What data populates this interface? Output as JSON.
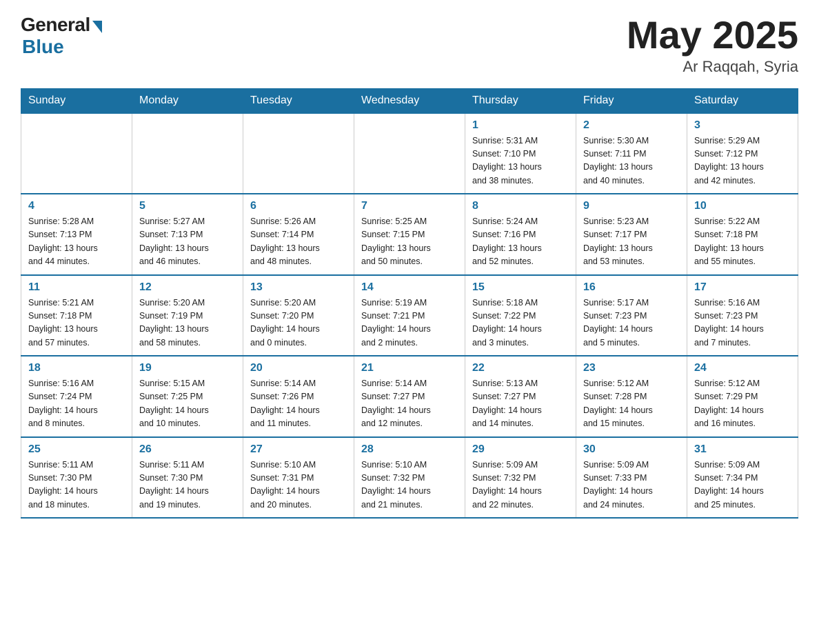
{
  "header": {
    "logo_general": "General",
    "logo_blue": "Blue",
    "title": "May 2025",
    "location": "Ar Raqqah, Syria"
  },
  "days_of_week": [
    "Sunday",
    "Monday",
    "Tuesday",
    "Wednesday",
    "Thursday",
    "Friday",
    "Saturday"
  ],
  "weeks": [
    [
      {
        "day": "",
        "info": ""
      },
      {
        "day": "",
        "info": ""
      },
      {
        "day": "",
        "info": ""
      },
      {
        "day": "",
        "info": ""
      },
      {
        "day": "1",
        "info": "Sunrise: 5:31 AM\nSunset: 7:10 PM\nDaylight: 13 hours\nand 38 minutes."
      },
      {
        "day": "2",
        "info": "Sunrise: 5:30 AM\nSunset: 7:11 PM\nDaylight: 13 hours\nand 40 minutes."
      },
      {
        "day": "3",
        "info": "Sunrise: 5:29 AM\nSunset: 7:12 PM\nDaylight: 13 hours\nand 42 minutes."
      }
    ],
    [
      {
        "day": "4",
        "info": "Sunrise: 5:28 AM\nSunset: 7:13 PM\nDaylight: 13 hours\nand 44 minutes."
      },
      {
        "day": "5",
        "info": "Sunrise: 5:27 AM\nSunset: 7:13 PM\nDaylight: 13 hours\nand 46 minutes."
      },
      {
        "day": "6",
        "info": "Sunrise: 5:26 AM\nSunset: 7:14 PM\nDaylight: 13 hours\nand 48 minutes."
      },
      {
        "day": "7",
        "info": "Sunrise: 5:25 AM\nSunset: 7:15 PM\nDaylight: 13 hours\nand 50 minutes."
      },
      {
        "day": "8",
        "info": "Sunrise: 5:24 AM\nSunset: 7:16 PM\nDaylight: 13 hours\nand 52 minutes."
      },
      {
        "day": "9",
        "info": "Sunrise: 5:23 AM\nSunset: 7:17 PM\nDaylight: 13 hours\nand 53 minutes."
      },
      {
        "day": "10",
        "info": "Sunrise: 5:22 AM\nSunset: 7:18 PM\nDaylight: 13 hours\nand 55 minutes."
      }
    ],
    [
      {
        "day": "11",
        "info": "Sunrise: 5:21 AM\nSunset: 7:18 PM\nDaylight: 13 hours\nand 57 minutes."
      },
      {
        "day": "12",
        "info": "Sunrise: 5:20 AM\nSunset: 7:19 PM\nDaylight: 13 hours\nand 58 minutes."
      },
      {
        "day": "13",
        "info": "Sunrise: 5:20 AM\nSunset: 7:20 PM\nDaylight: 14 hours\nand 0 minutes."
      },
      {
        "day": "14",
        "info": "Sunrise: 5:19 AM\nSunset: 7:21 PM\nDaylight: 14 hours\nand 2 minutes."
      },
      {
        "day": "15",
        "info": "Sunrise: 5:18 AM\nSunset: 7:22 PM\nDaylight: 14 hours\nand 3 minutes."
      },
      {
        "day": "16",
        "info": "Sunrise: 5:17 AM\nSunset: 7:23 PM\nDaylight: 14 hours\nand 5 minutes."
      },
      {
        "day": "17",
        "info": "Sunrise: 5:16 AM\nSunset: 7:23 PM\nDaylight: 14 hours\nand 7 minutes."
      }
    ],
    [
      {
        "day": "18",
        "info": "Sunrise: 5:16 AM\nSunset: 7:24 PM\nDaylight: 14 hours\nand 8 minutes."
      },
      {
        "day": "19",
        "info": "Sunrise: 5:15 AM\nSunset: 7:25 PM\nDaylight: 14 hours\nand 10 minutes."
      },
      {
        "day": "20",
        "info": "Sunrise: 5:14 AM\nSunset: 7:26 PM\nDaylight: 14 hours\nand 11 minutes."
      },
      {
        "day": "21",
        "info": "Sunrise: 5:14 AM\nSunset: 7:27 PM\nDaylight: 14 hours\nand 12 minutes."
      },
      {
        "day": "22",
        "info": "Sunrise: 5:13 AM\nSunset: 7:27 PM\nDaylight: 14 hours\nand 14 minutes."
      },
      {
        "day": "23",
        "info": "Sunrise: 5:12 AM\nSunset: 7:28 PM\nDaylight: 14 hours\nand 15 minutes."
      },
      {
        "day": "24",
        "info": "Sunrise: 5:12 AM\nSunset: 7:29 PM\nDaylight: 14 hours\nand 16 minutes."
      }
    ],
    [
      {
        "day": "25",
        "info": "Sunrise: 5:11 AM\nSunset: 7:30 PM\nDaylight: 14 hours\nand 18 minutes."
      },
      {
        "day": "26",
        "info": "Sunrise: 5:11 AM\nSunset: 7:30 PM\nDaylight: 14 hours\nand 19 minutes."
      },
      {
        "day": "27",
        "info": "Sunrise: 5:10 AM\nSunset: 7:31 PM\nDaylight: 14 hours\nand 20 minutes."
      },
      {
        "day": "28",
        "info": "Sunrise: 5:10 AM\nSunset: 7:32 PM\nDaylight: 14 hours\nand 21 minutes."
      },
      {
        "day": "29",
        "info": "Sunrise: 5:09 AM\nSunset: 7:32 PM\nDaylight: 14 hours\nand 22 minutes."
      },
      {
        "day": "30",
        "info": "Sunrise: 5:09 AM\nSunset: 7:33 PM\nDaylight: 14 hours\nand 24 minutes."
      },
      {
        "day": "31",
        "info": "Sunrise: 5:09 AM\nSunset: 7:34 PM\nDaylight: 14 hours\nand 25 minutes."
      }
    ]
  ]
}
